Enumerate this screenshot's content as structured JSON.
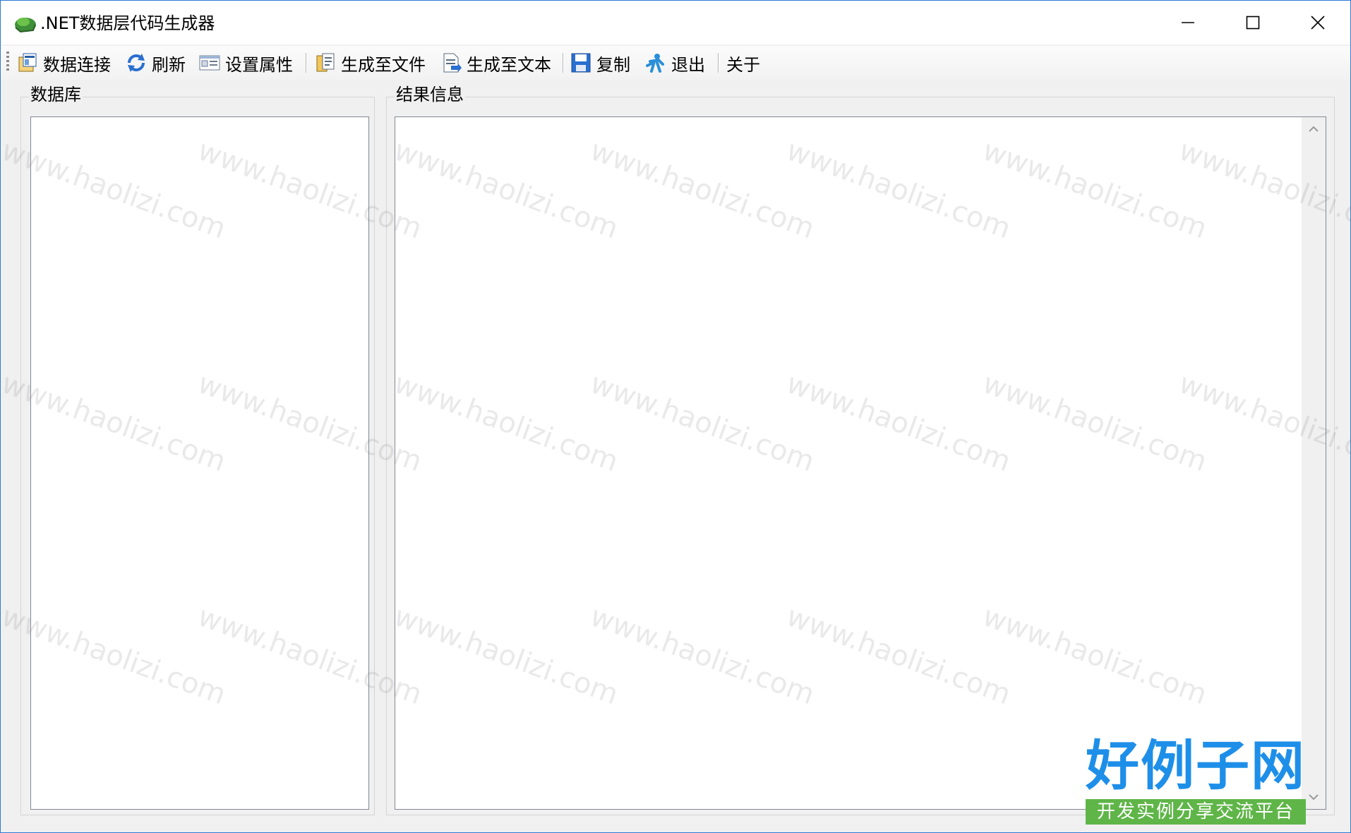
{
  "window": {
    "title": ".NET数据层代码生成器"
  },
  "toolbar": {
    "items": [
      {
        "label": "数据连接",
        "icon": "database-connect-icon"
      },
      {
        "label": "刷新",
        "icon": "refresh-icon"
      },
      {
        "label": "设置属性",
        "icon": "properties-icon"
      },
      {
        "label": "生成至文件",
        "icon": "generate-file-icon"
      },
      {
        "label": "生成至文本",
        "icon": "generate-text-icon"
      },
      {
        "label": "复制",
        "icon": "save-disk-icon"
      },
      {
        "label": "退出",
        "icon": "exit-icon"
      },
      {
        "label": "关于",
        "icon": ""
      }
    ]
  },
  "left_panel": {
    "title": "数据库"
  },
  "right_panel": {
    "title": "结果信息"
  },
  "watermark": {
    "text": "www.haolizi.com"
  },
  "brand": {
    "name": "好例子网",
    "tagline": "开发实例分享交流平台"
  },
  "colors": {
    "window_border": "#2b7bd6",
    "brand_blue": "#1e8fe8",
    "brand_green": "#5fb548"
  }
}
